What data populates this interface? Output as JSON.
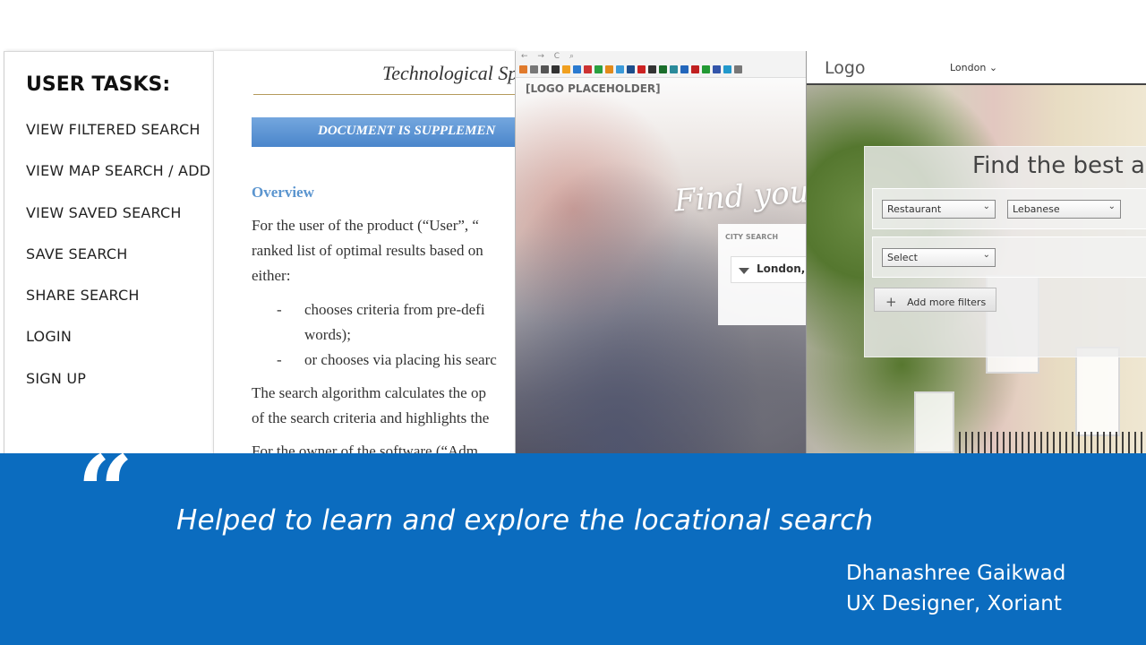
{
  "user_tasks": {
    "heading": "USER TASKS:",
    "items": [
      "VIEW FILTERED SEARCH",
      "VIEW MAP SEARCH / ADD F",
      "VIEW SAVED SEARCH",
      "SAVE SEARCH",
      "SHARE SEARCH",
      "LOGIN",
      "SIGN UP"
    ]
  },
  "document": {
    "title": "Technological Spe",
    "banner": "DOCUMENT IS SUPPLEMEN",
    "section": "Overview",
    "lines": [
      "For the user of the product (“User”, “",
      "ranked list of optimal results based on",
      "either:"
    ],
    "bullets": [
      [
        "chooses criteria from pre-defi",
        "words);"
      ],
      [
        "or chooses via placing his searc"
      ]
    ],
    "after_lines": [
      "The search algorithm calculates the op",
      "of the search criteria and highlights the",
      "For the owner of the software (“Adm"
    ],
    "dash": "-"
  },
  "browser_mockup": {
    "nav": "← → C  ⌕",
    "logo_placeholder": "[LOGO PLACEHOLDER]",
    "script_heading": "Find your pe",
    "city_search_label": "CITY SEARCH",
    "city_value": "London,",
    "bookmark_colors": [
      "#e07a2c",
      "#777",
      "#555",
      "#333",
      "#f0a020",
      "#2a7ad0",
      "#c33",
      "#2aa040",
      "#e28a1a",
      "#3a9ad9",
      "#1d4e8c",
      "#c22",
      "#333",
      "#1a6d2a",
      "#2a8a9a",
      "#2266bb",
      "#c02020",
      "#229933",
      "#3355aa",
      "#2299cc",
      "#777"
    ]
  },
  "street_mockup": {
    "logo": "Logo",
    "location": "London",
    "location_chevron": "⌄",
    "heading": "Find the best are",
    "select_1": "Restaurant",
    "select_2": "Lebanese",
    "select_3": "Select",
    "add_filters": "Add more filters",
    "add_icon": "+"
  },
  "testimonial": {
    "mark": "“",
    "quote": "Helped to learn and explore the locational search",
    "author_name": "Dhanashree Gaikwad",
    "author_role": "UX Designer, Xoriant"
  }
}
